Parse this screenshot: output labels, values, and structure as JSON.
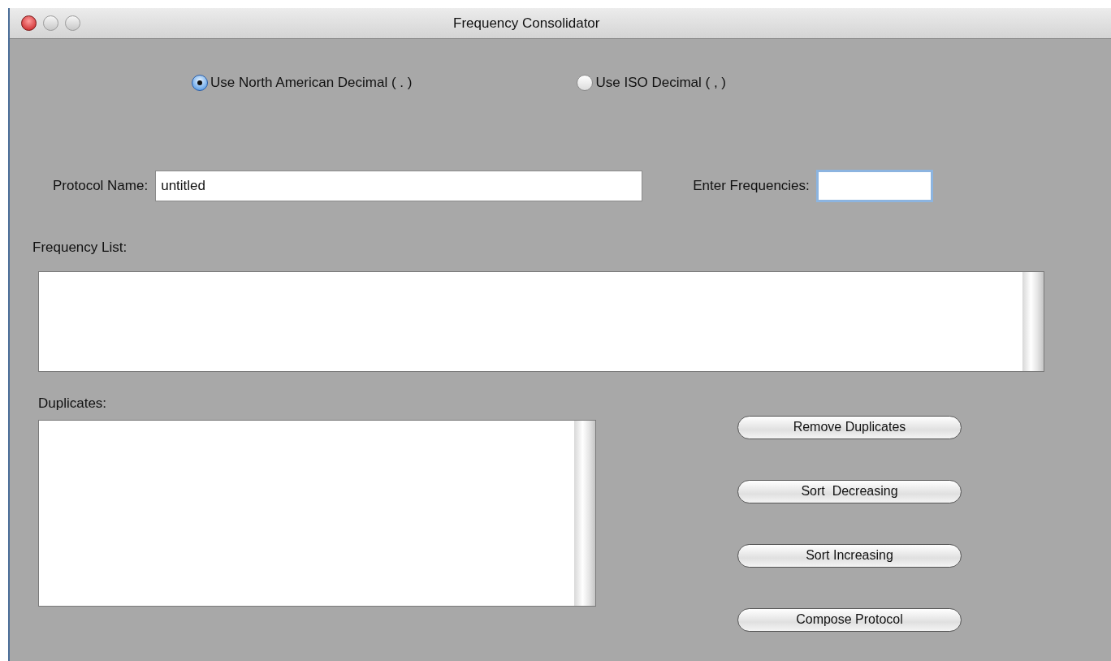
{
  "window": {
    "title": "Frequency Consolidator"
  },
  "decimal_options": [
    {
      "label": "Use North American Decimal ( . )",
      "selected": true
    },
    {
      "label": "Use ISO Decimal ( , )",
      "selected": false
    }
  ],
  "protocol_name": {
    "label": "Protocol Name:",
    "value": "untitled"
  },
  "enter_frequencies": {
    "label": "Enter Frequencies:"
  },
  "frequency_list": {
    "label": "Frequency List:"
  },
  "duplicates": {
    "label": "Duplicates:"
  },
  "buttons": [
    "Remove Duplicates",
    "Sort  Decreasing",
    "Sort Increasing",
    "Compose Protocol"
  ]
}
